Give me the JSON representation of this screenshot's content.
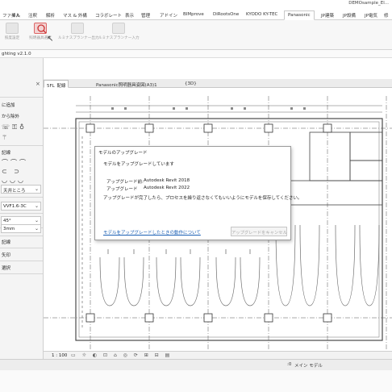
{
  "titlebar": {
    "document": "DEMOsample_El..."
  },
  "ribbon_tabs": [
    {
      "label": "ファイル",
      "active": false
    },
    {
      "label": "挿入",
      "active": false
    },
    {
      "label": "注釈",
      "active": false
    },
    {
      "label": "解析",
      "active": false
    },
    {
      "label": "マス & 外構",
      "active": false
    },
    {
      "label": "コラボレート",
      "active": false
    },
    {
      "label": "表示",
      "active": false
    },
    {
      "label": "管理",
      "active": false
    },
    {
      "label": "アドイン",
      "active": false
    },
    {
      "label": "BIMprove",
      "active": false
    },
    {
      "label": "DiRootsOne",
      "active": false
    },
    {
      "label": "KYODO KY-TEC",
      "active": false
    },
    {
      "label": "Panasonic",
      "active": true
    },
    {
      "label": "JP建築",
      "active": false
    },
    {
      "label": "JP設備",
      "active": false
    },
    {
      "label": "JP電気",
      "active": false
    },
    {
      "label": "修",
      "active": false
    }
  ],
  "ribbon_buttons": [
    {
      "label": "照度設定",
      "icon": "lux-settings-icon"
    },
    {
      "label": "照明器具選定",
      "icon": "fixture-select-icon"
    },
    {
      "label": "ルミナスプランナー出力",
      "icon": "export-icon"
    },
    {
      "label": "ルミナスプランナー入力",
      "icon": "import-icon"
    }
  ],
  "panel_strip": {
    "title": "ghting v2.1.0"
  },
  "palette": {
    "items": [
      {
        "label": "に追加"
      },
      {
        "label": "から除外"
      },
      {
        "label": "記線"
      },
      {
        "label": "天井ところ",
        "dropdown": true
      },
      {
        "label": "VVF1.6-3C",
        "dropdown": true
      },
      {
        "label": "45°",
        "dropdown": true
      },
      {
        "label": "3mm",
        "dropdown": true
      },
      {
        "label": "記線"
      },
      {
        "label": "矢印"
      },
      {
        "label": "選択"
      }
    ]
  },
  "view_tabs": [
    {
      "label": "5FL_配線",
      "active": true
    },
    {
      "label": "Panasonic照明器具姿図(A3)1",
      "active": false
    },
    {
      "label": "{3D}",
      "active": false
    }
  ],
  "dialog": {
    "title": "モデルのアップグレード",
    "status": "モデルをアップグレードしています",
    "rows": [
      {
        "key": "アップグレード前:",
        "value": "Autodesk Revit 2018"
      },
      {
        "key": "アップグレード",
        "value": "Autodesk Revit 2022"
      }
    ],
    "message": "アップグレードが完了したら、プロセスを繰り返さなくてもいいようにモデルを保存してください。",
    "link": "モデルをアップグレードしたときの動作について",
    "cancel_button": "アップグレードをキャンセル"
  },
  "viewbar": {
    "scale": "1 : 100"
  },
  "statusbar": {
    "zero": ":0",
    "model": "メイン モデル"
  },
  "colors": {
    "accent": "#1a5fb4",
    "line": "#4a4a4a"
  }
}
